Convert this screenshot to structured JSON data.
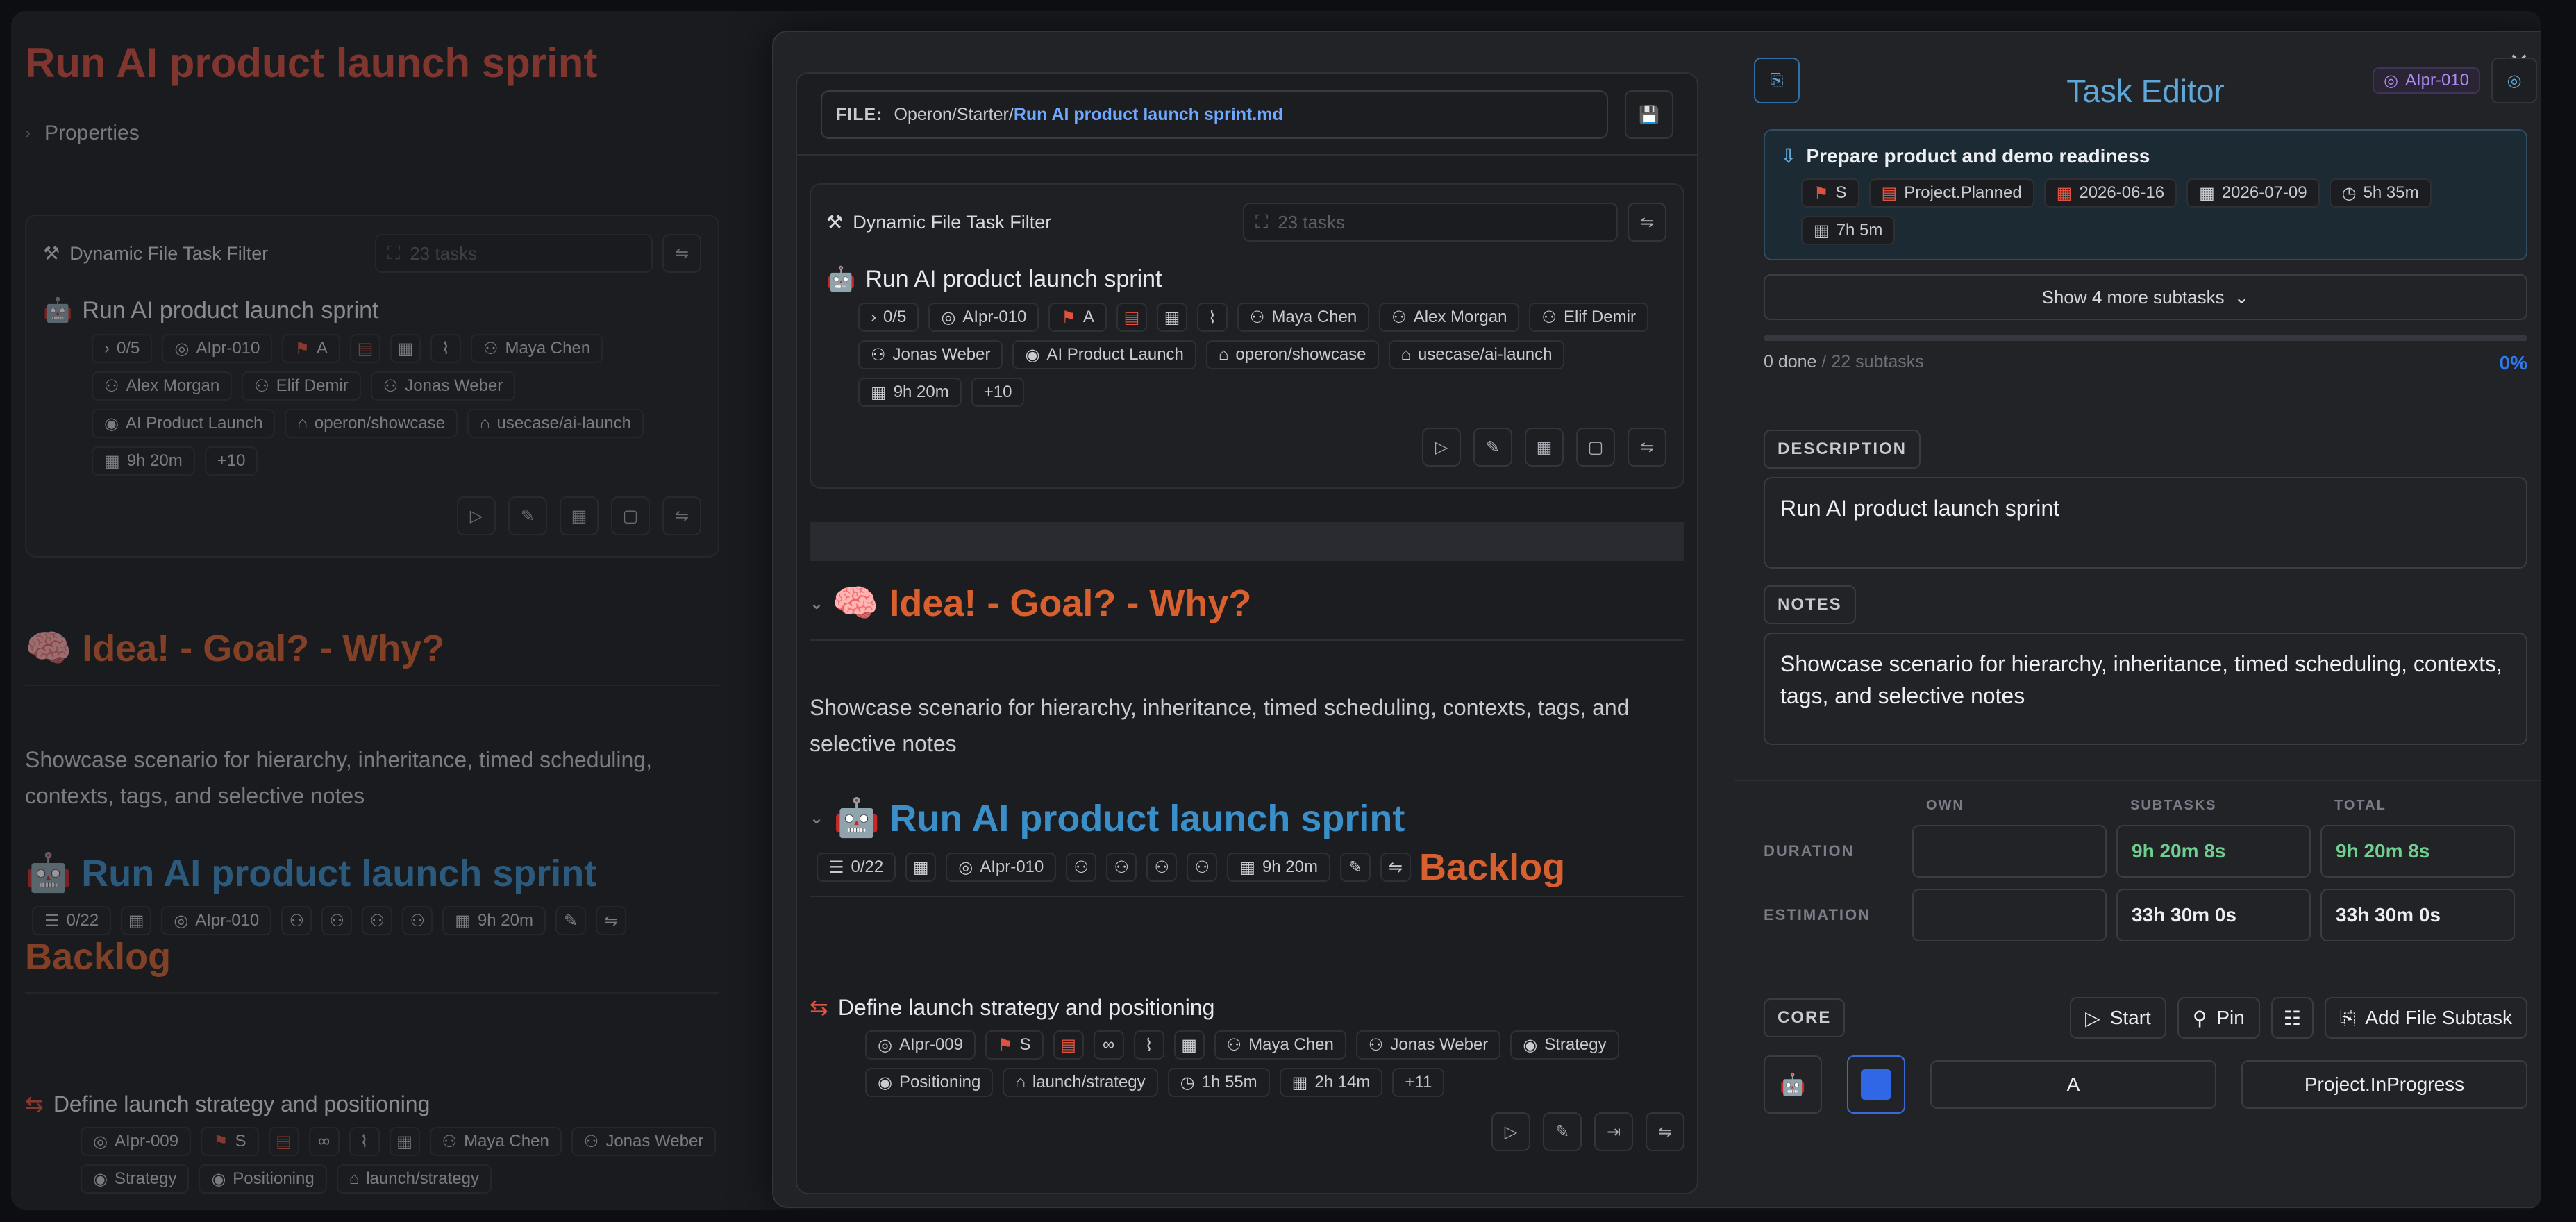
{
  "colors": {
    "accent_red": "#e0523f",
    "accent_orange": "#d8602e",
    "accent_blue": "#3a8fc9",
    "link_blue": "#6fa8ff",
    "progress_blue": "#2f7af0",
    "duration_green": "#6fcf8f",
    "tag_purple": "#a98cf0"
  },
  "page": {
    "title": "Run AI product launch sprint",
    "properties_label": "Properties",
    "filter": {
      "title": "Dynamic File Task Filter",
      "placeholder": "23 tasks"
    },
    "task": {
      "title": "Run AI product launch sprint",
      "chips": [
        "0/5",
        "AIpr-010",
        "A",
        "Maya Chen",
        "Alex Morgan",
        "Elif Demir",
        "Jonas Weber",
        "AI Product Launch",
        "operon/showcase",
        "usecase/ai-launch",
        "9h 20m",
        "+10"
      ]
    },
    "heading": "🧠 Idea! - Goal? - Why?",
    "paragraph": "Showcase scenario for hierarchy, inheritance, timed scheduling, contexts, tags, and selective notes",
    "section": {
      "title": "Run AI product launch sprint",
      "progress": "0/22",
      "id": "AIpr-010",
      "duration": "9h 20m",
      "tail": "Backlog"
    },
    "subtask": {
      "title": "Define launch strategy and positioning",
      "chips": [
        "AIpr-009",
        "S",
        "Maya Chen",
        "Jonas Weber",
        "Strategy",
        "Positioning",
        "launch/strategy"
      ]
    }
  },
  "modal": {
    "file": {
      "label": "FILE:",
      "path": "Operon/Starter/",
      "name": "Run AI product launch sprint.md"
    },
    "filter": {
      "title": "Dynamic File Task Filter",
      "placeholder": "23 tasks"
    },
    "task": {
      "title": "Run AI product launch sprint",
      "chips": [
        "0/5",
        "AIpr-010",
        "A",
        "Maya Chen",
        "Alex Morgan",
        "Elif Demir",
        "Jonas Weber",
        "AI Product Launch",
        "operon/showcase",
        "usecase/ai-launch",
        "9h 20m",
        "+10"
      ]
    },
    "heading": "🧠 Idea! - Goal? - Why?",
    "paragraph": "Showcase scenario for hierarchy, inheritance, timed scheduling, contexts, tags, and selective notes",
    "section": {
      "title": "Run AI product launch sprint",
      "progress": "0/22",
      "id": "AIpr-010",
      "duration": "9h 20m",
      "tail": "Backlog"
    },
    "subtask": {
      "title": "Define launch strategy and positioning",
      "chips": [
        "AIpr-009",
        "S",
        "Maya Chen",
        "Jonas Weber",
        "Strategy",
        "Positioning",
        "launch/strategy",
        "1h 55m",
        "2h 14m",
        "+11"
      ]
    }
  },
  "editor": {
    "title": "Task Editor",
    "task_id": "AIpr-010",
    "subtask": {
      "title": "Prepare product and demo readiness",
      "chips": [
        "S",
        "Project.Planned",
        "2026-06-16",
        "2026-07-09",
        "5h 35m",
        "7h 5m"
      ]
    },
    "show_more": "Show 4 more subtasks",
    "progress": {
      "done": "0 done",
      "total": "/ 22 subtasks",
      "percent": "0%",
      "fraction": 0.0
    },
    "description_label": "DESCRIPTION",
    "description": "Run AI product launch sprint",
    "notes_label": "NOTES",
    "notes": "Showcase scenario for hierarchy, inheritance, timed scheduling, contexts, tags, and selective notes",
    "time": {
      "headers": [
        "OWN",
        "SUBTASKS",
        "TOTAL"
      ],
      "duration_label": "DURATION",
      "estimation_label": "ESTIMATION",
      "duration": {
        "own": "",
        "subtasks": "9h 20m 8s",
        "total": "9h 20m 8s"
      },
      "estimation": {
        "own": "",
        "subtasks": "33h 30m 0s",
        "total": "33h 30m 0s"
      }
    },
    "core_label": "CORE",
    "buttons": {
      "start": "Start",
      "pin": "Pin",
      "add_subtask": "Add File Subtask"
    },
    "priority": "A",
    "status": "Project.InProgress"
  }
}
